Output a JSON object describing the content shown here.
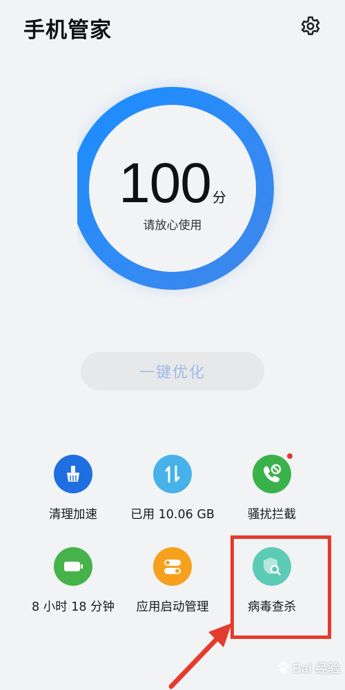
{
  "header": {
    "title": "手机管家",
    "settings_icon": "gear-icon"
  },
  "score": {
    "value": "100",
    "unit": "分",
    "subtitle": "请放心使用",
    "progress_percent": 100
  },
  "optimize_button": {
    "label": "一键优化"
  },
  "tools": [
    {
      "label": "清理加速",
      "icon": "broom-icon",
      "color": "#1f6fe0"
    },
    {
      "label": "已用 10.06 GB",
      "icon": "data-transfer-icon",
      "color": "#46b2e9"
    },
    {
      "label": "骚扰拦截",
      "icon": "phone-block-icon",
      "color": "#39b24a",
      "badge": true
    },
    {
      "label": "8 小时 18 分钟",
      "icon": "battery-icon",
      "color": "#46b34a"
    },
    {
      "label": "应用启动管理",
      "icon": "toggle-icon",
      "color": "#f5a11d"
    },
    {
      "label": "病毒查杀",
      "icon": "shield-search-icon",
      "color": "#5ccbb6"
    }
  ],
  "annotation": {
    "highlight_color": "#e53b2c"
  },
  "watermark": {
    "text": "Bai 经验"
  }
}
